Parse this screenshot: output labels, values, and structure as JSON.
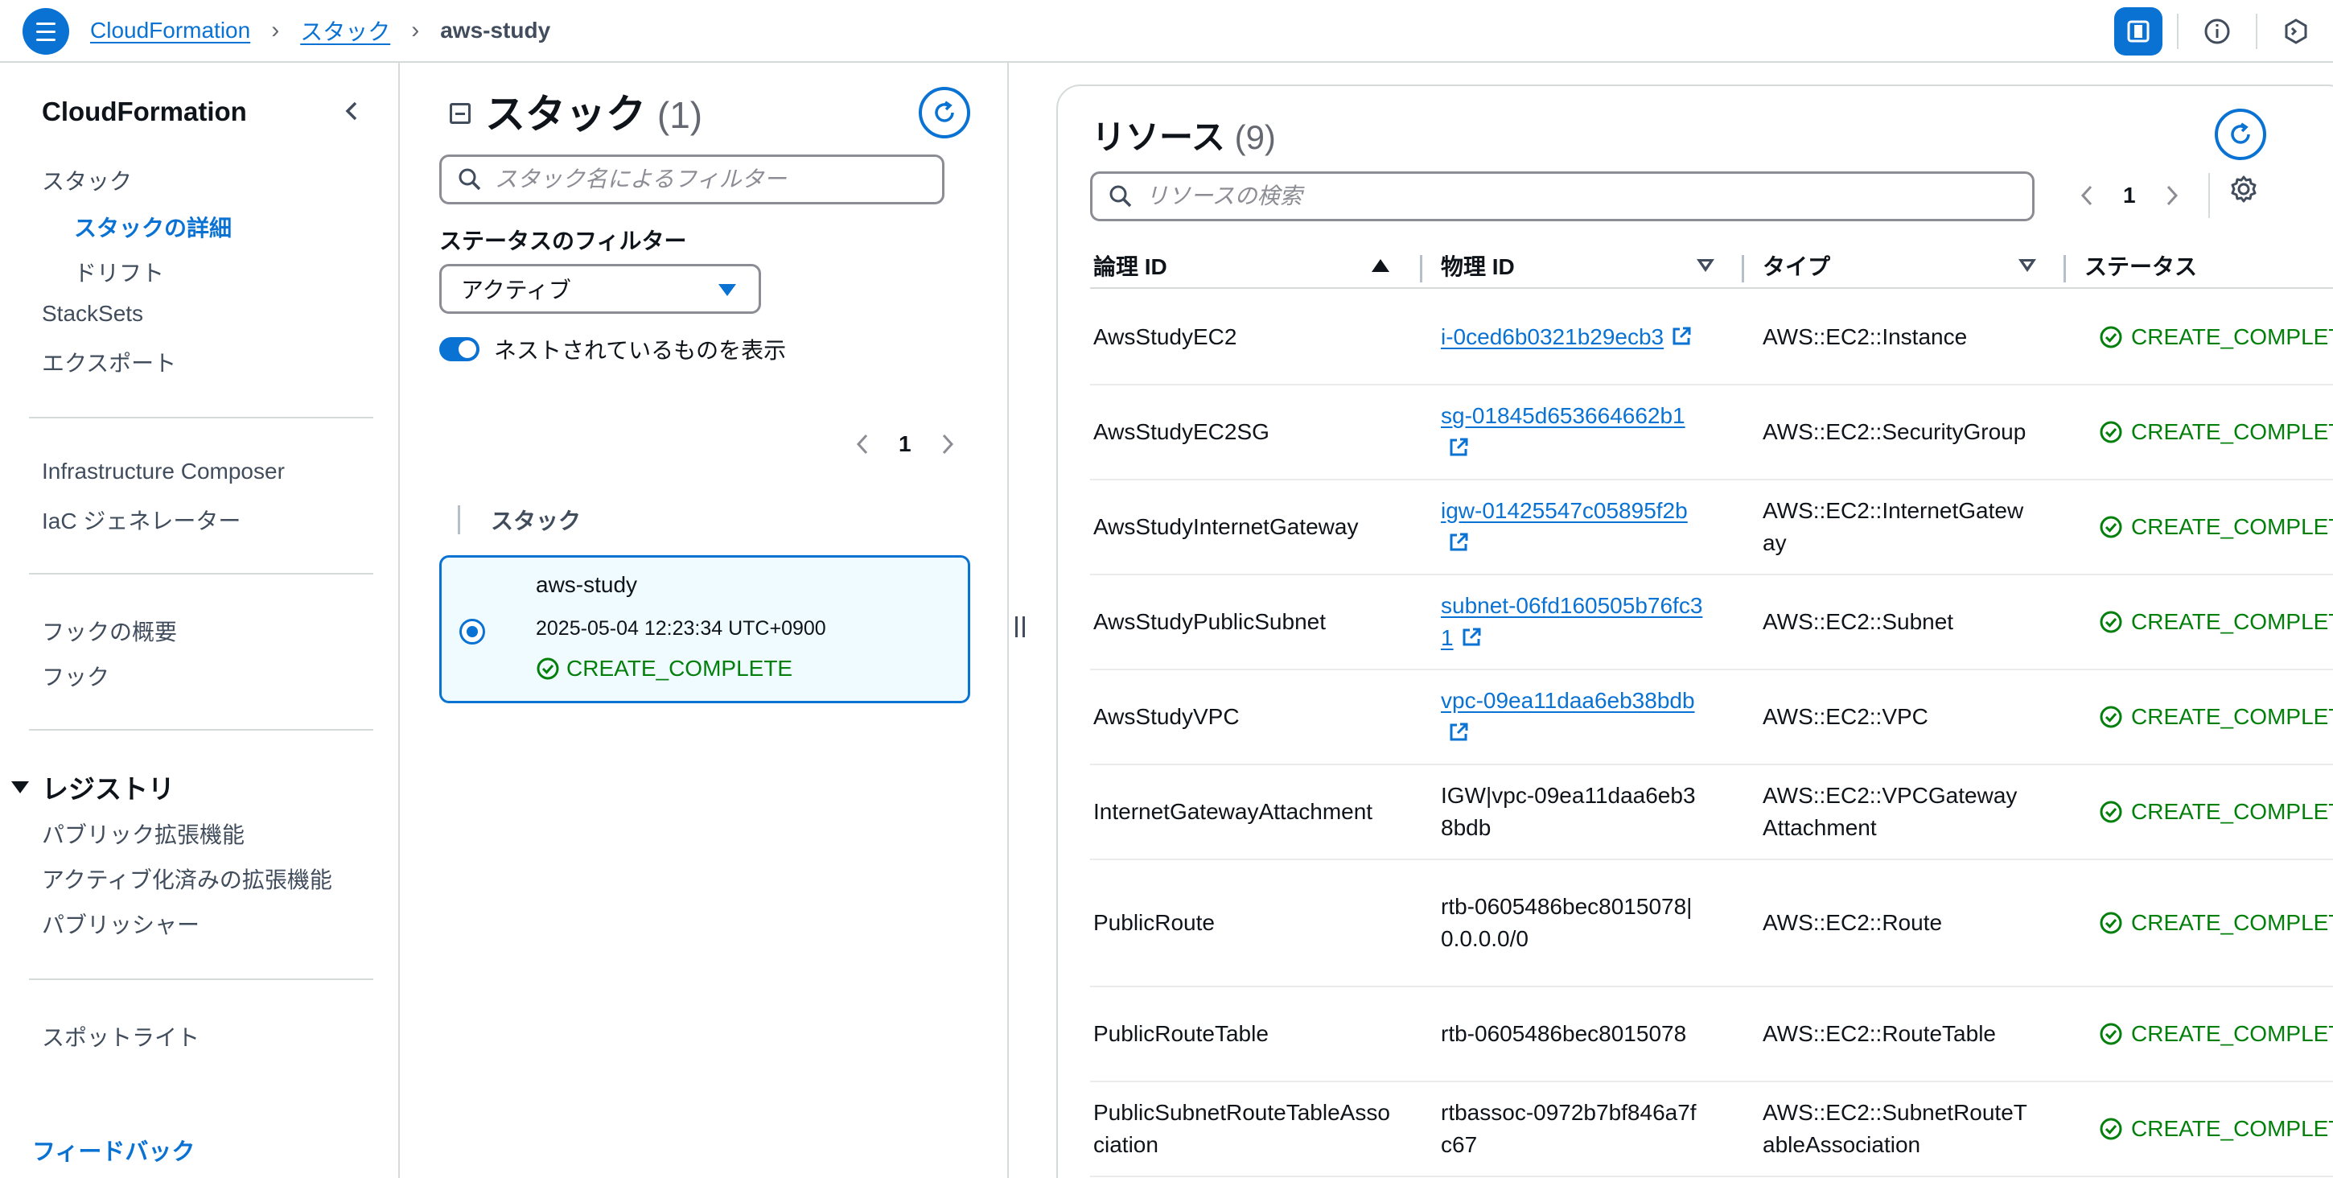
{
  "topbar": {
    "breadcrumbs": [
      "CloudFormation",
      "スタック"
    ],
    "current": "aws-study",
    "separator": "›",
    "icons": [
      "panel-icon",
      "info-icon",
      "cloudshell-icon"
    ]
  },
  "sidebar": {
    "title": "CloudFormation",
    "items": [
      {
        "label": "スタック"
      },
      {
        "label": "スタックの詳細"
      },
      {
        "label": "ドリフト"
      },
      {
        "label": "StackSets"
      },
      {
        "label": "エクスポート"
      },
      {
        "label": "Infrastructure Composer"
      },
      {
        "label": "IaC ジェネレーター"
      },
      {
        "label": "フックの概要"
      },
      {
        "label": "フック"
      },
      {
        "label": "パブリック拡張機能"
      },
      {
        "label": "アクティブ化済みの拡張機能"
      },
      {
        "label": "パブリッシャー"
      },
      {
        "label": "スポットライト"
      }
    ],
    "registry_label": "レジストリ",
    "feedback": "フィードバック"
  },
  "stacks": {
    "title": "スタック",
    "count": "(1)",
    "search_placeholder": "スタック名によるフィルター",
    "filter_label": "ステータスのフィルター",
    "filter_value": "アクティブ",
    "toggle_label": "ネストされているものを表示",
    "page": "1",
    "column_header": "スタック",
    "items": [
      {
        "name": "aws-study",
        "date": "2025-05-04 12:23:34 UTC+0900",
        "status": "CREATE_COMPLETE"
      }
    ]
  },
  "resources": {
    "title": "リソース",
    "count": "(9)",
    "search_placeholder": "リソースの検索",
    "page": "1",
    "columns": [
      "論理 ID",
      "物理 ID",
      "タイプ",
      "ステータス"
    ],
    "rows": [
      {
        "logical": "AwsStudyEC2",
        "physical": "i-0ced6b0321b29ecb3",
        "link": true,
        "type": "AWS::EC2::Instance",
        "status": "CREATE_COMPLETE"
      },
      {
        "logical": "AwsStudyEC2SG",
        "physical": "sg-01845d653664662b1",
        "link": true,
        "type": "AWS::EC2::SecurityGroup",
        "status": "CREATE_COMPLETE"
      },
      {
        "logical": "AwsStudyInternetGateway",
        "physical": "igw-01425547c05895f2b",
        "link": true,
        "type": "AWS::EC2::InternetGateway",
        "status": "CREATE_COMPLETE"
      },
      {
        "logical": "AwsStudyPublicSubnet",
        "physical": "subnet-06fd160505b76fc31",
        "link": true,
        "type": "AWS::EC2::Subnet",
        "status": "CREATE_COMPLETE"
      },
      {
        "logical": "AwsStudyVPC",
        "physical": "vpc-09ea11daa6eb38bdb",
        "link": true,
        "type": "AWS::EC2::VPC",
        "status": "CREATE_COMPLETE"
      },
      {
        "logical": "InternetGatewayAttachment",
        "physical": "IGW|vpc-09ea11daa6eb38bdb",
        "link": false,
        "type": "AWS::EC2::VPCGatewayAttachment",
        "status": "CREATE_COMPLETE"
      },
      {
        "logical": "PublicRoute",
        "physical": "rtb-0605486bec8015078|0.0.0.0/0",
        "link": false,
        "type": "AWS::EC2::Route",
        "status": "CREATE_COMPLETE"
      },
      {
        "logical": "PublicRouteTable",
        "physical": "rtb-0605486bec8015078",
        "link": false,
        "type": "AWS::EC2::RouteTable",
        "status": "CREATE_COMPLETE"
      },
      {
        "logical": "PublicSubnetRouteTableAssociation",
        "physical": "rtbassoc-0972b7bf846a7fc67",
        "link": false,
        "type": "AWS::EC2::SubnetRouteTableAssociation",
        "status": "CREATE_COMPLETE"
      }
    ]
  }
}
